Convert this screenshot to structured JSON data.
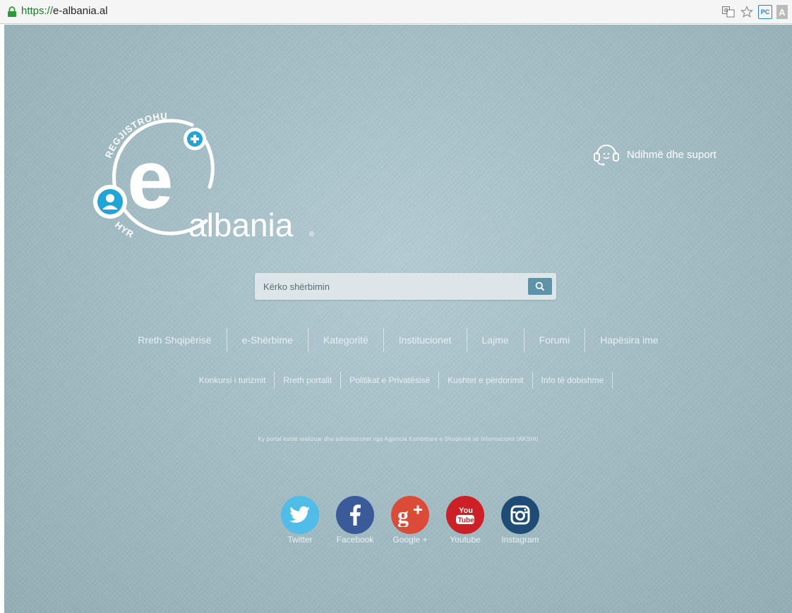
{
  "browser": {
    "url_scheme": "https://",
    "url_host": "e-albania.al",
    "toolbar_icons": [
      "translate-icon",
      "star-icon",
      "pc-extension-icon",
      "a-extension-icon"
    ],
    "pc_label": "PC",
    "a_label": "A"
  },
  "logo": {
    "top_arc": "REGJISTROHU",
    "bottom_arc": "HYR",
    "letter": "e",
    "wordmark": "albania",
    "registered": "®"
  },
  "help": {
    "label": "Ndihmë dhe suport"
  },
  "search": {
    "placeholder": "Kërko shërbimin"
  },
  "main_nav": [
    "Rreth Shqipërisë",
    "e-Shërbime",
    "Kategoritë",
    "Institucionet",
    "Lajme",
    "Forumi",
    "Hapësira ime"
  ],
  "sub_nav": [
    "Konkursi i turizmit",
    "Rreth portalit",
    "Politikat e Privatësisë",
    "Kushtet e përdorimit",
    "Info të dobishme"
  ],
  "credit": "Ky portal është realizuar dhe administrohet nga Agjencia Kombëtare e Shoqërisë së Informacionit (AKSHI)",
  "social": [
    {
      "label": "Twitter",
      "icon": "twitter-icon",
      "color": "#4fbde8"
    },
    {
      "label": "Facebook",
      "icon": "facebook-icon",
      "color": "#3b5a9a"
    },
    {
      "label": "Google +",
      "icon": "google-plus-icon",
      "color": "#dc4a38"
    },
    {
      "label": "Youtube",
      "icon": "youtube-icon",
      "color": "#cc1f26"
    },
    {
      "label": "Instagram",
      "icon": "instagram-icon",
      "color": "#1f4c74"
    }
  ],
  "colors": {
    "accent": "#1fa6d6",
    "page_bg": "#9fb9c1",
    "search_button": "#5d93a8"
  }
}
